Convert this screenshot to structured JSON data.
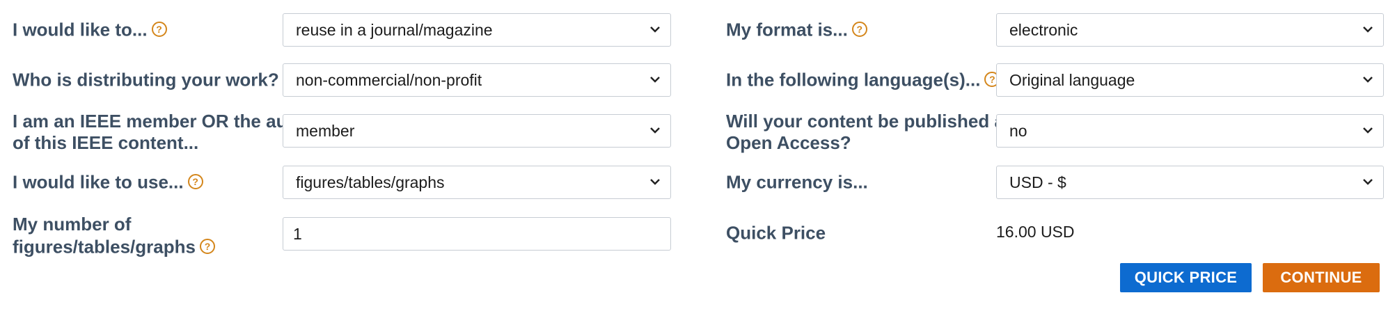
{
  "left": {
    "reuse_type": {
      "label": "I would like to...",
      "value": "reuse in a journal/magazine"
    },
    "distributor": {
      "label": "Who is distributing your work?",
      "value": "non-commercial/non-profit"
    },
    "member": {
      "label_line1": "I am an IEEE member OR the author",
      "label_line2": "of this IEEE content...",
      "value": "member"
    },
    "use_type": {
      "label": "I would like to use...",
      "value": "figures/tables/graphs"
    },
    "quantity": {
      "label_line1": "My number of",
      "label_line2": "figures/tables/graphs",
      "value": "1"
    }
  },
  "right": {
    "format": {
      "label": "My format is...",
      "value": "electronic"
    },
    "language": {
      "label": "In the following language(s)...",
      "value": "Original language"
    },
    "open_access": {
      "label_line1": "Will your content be published as",
      "label_line2": "Open Access?",
      "value": "no"
    },
    "currency": {
      "label": "My currency is...",
      "value": "USD - $"
    },
    "quick_price": {
      "label": "Quick Price",
      "value": "16.00 USD"
    }
  },
  "help_glyph": "?",
  "buttons": {
    "quick_price": "QUICK PRICE",
    "continue": "CONTINUE"
  },
  "colors": {
    "label": "#3d4f63",
    "help_icon": "#d4861b",
    "quick_price_button": "#0d6bd0",
    "continue_button": "#db6c0f"
  },
  "icons": {
    "help": "help-icon",
    "dropdown": "chevron-down-icon"
  }
}
